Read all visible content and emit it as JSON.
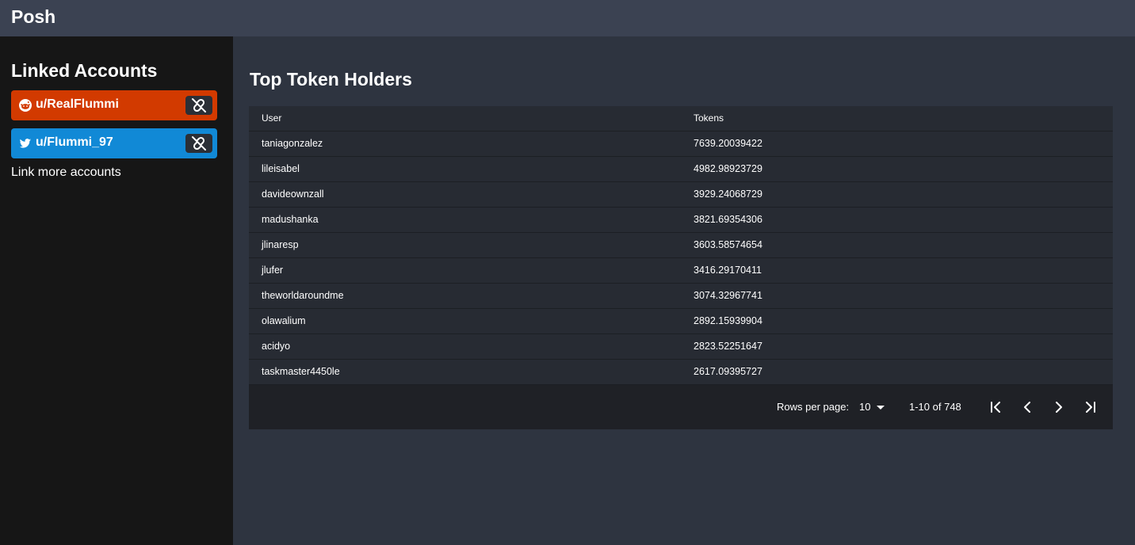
{
  "app": {
    "title": "Posh"
  },
  "sidebar": {
    "title": "Linked Accounts",
    "accounts": [
      {
        "platform": "reddit",
        "name": "u/RealFlummi",
        "color": "#d23a00",
        "icon": "reddit-icon"
      },
      {
        "platform": "twitter",
        "name": "u/Flummi_97",
        "color": "#1189d6",
        "icon": "twitter-icon"
      }
    ],
    "link_more": "Link more accounts"
  },
  "main": {
    "title": "Top Token Holders",
    "table": {
      "columns": [
        "User",
        "Tokens"
      ],
      "rows": [
        {
          "user": "taniagonzalez",
          "tokens": "7639.20039422"
        },
        {
          "user": "lileisabel",
          "tokens": "4982.98923729"
        },
        {
          "user": "davideownzall",
          "tokens": "3929.24068729"
        },
        {
          "user": "madushanka",
          "tokens": "3821.69354306"
        },
        {
          "user": "jlinaresp",
          "tokens": "3603.58574654"
        },
        {
          "user": "jlufer",
          "tokens": "3416.29170411"
        },
        {
          "user": "theworldaroundme",
          "tokens": "3074.32967741"
        },
        {
          "user": "olawalium",
          "tokens": "2892.15939904"
        },
        {
          "user": "acidyo",
          "tokens": "2823.52251647"
        },
        {
          "user": "taskmaster4450le",
          "tokens": "2617.09395727"
        }
      ]
    },
    "pagination": {
      "rows_per_page_label": "Rows per page:",
      "rows_per_page_value": "10",
      "range": "1-10 of 748"
    }
  }
}
